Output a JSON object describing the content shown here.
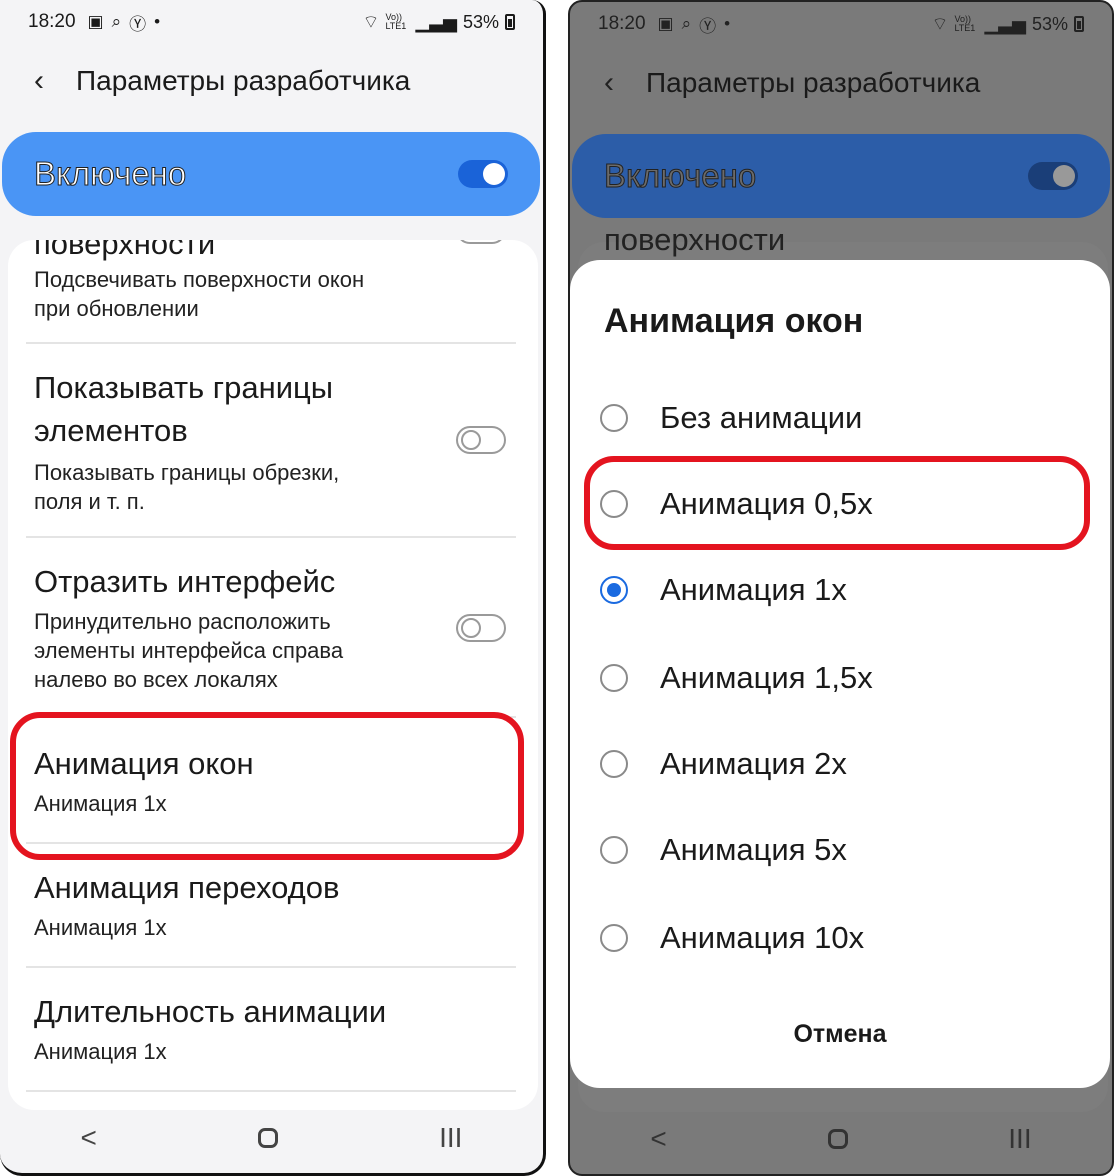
{
  "status": {
    "time": "18:20",
    "icons": [
      "image-icon",
      "search-icon",
      "yandex-icon",
      "dot-icon"
    ],
    "right": "53%",
    "network": "Vo)) LTE1"
  },
  "header": {
    "title": "Параметры разработчика"
  },
  "master": {
    "label": "Включено",
    "enabled": true
  },
  "list": {
    "partial_title": "поверхности",
    "items": [
      {
        "sub": "Подсвечивать поверхности окон",
        "sub2": "при обновлении"
      },
      {
        "title": "Показывать границы",
        "title2": "элементов",
        "sub": "Показывать границы обрезки,",
        "sub2": "поля и т. п."
      },
      {
        "title": "Отразить интерфейс",
        "sub": "Принудительно расположить",
        "sub2": "элементы интерфейса справа",
        "sub3": "налево во всех локалях"
      },
      {
        "title": "Анимация окон",
        "sub": "Анимация 1x"
      },
      {
        "title": "Анимация переходов",
        "sub": "Анимация 1x"
      },
      {
        "title": "Длительность анимации",
        "sub": "Анимация 1x"
      }
    ]
  },
  "dialog": {
    "title": "Анимация окон",
    "options": [
      {
        "label": "Без анимации",
        "checked": false
      },
      {
        "label": "Анимация 0,5x",
        "checked": false
      },
      {
        "label": "Анимация 1x",
        "checked": true
      },
      {
        "label": "Анимация 1,5x",
        "checked": false
      },
      {
        "label": "Анимация 2x",
        "checked": false
      },
      {
        "label": "Анимация 5x",
        "checked": false
      },
      {
        "label": "Анимация 10x",
        "checked": false
      }
    ],
    "cancel_label": "Отмена"
  },
  "nav": {
    "back": "<",
    "recents": "III"
  },
  "colors": {
    "accent": "#4a95f5",
    "highlight": "#e4141f",
    "radio": "#1a6ae0"
  }
}
